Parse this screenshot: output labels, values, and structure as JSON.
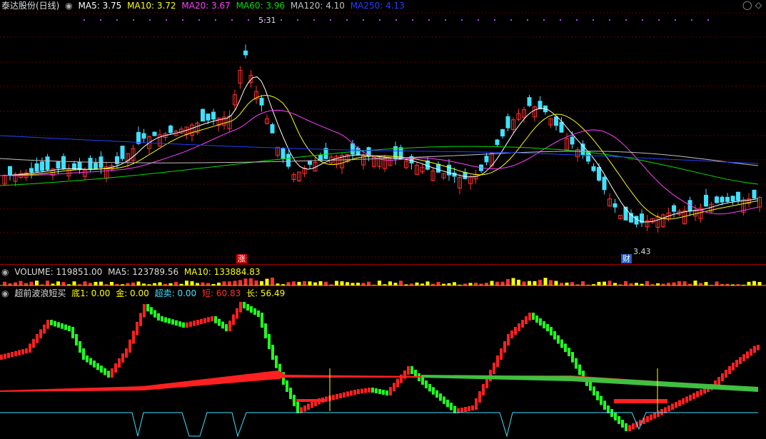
{
  "main_header": {
    "stock": "泰达股份(日线)",
    "ma": [
      {
        "label": "MA5: 3.75",
        "color": "#ffffff"
      },
      {
        "label": "MA10: 3.72",
        "color": "#ffff00"
      },
      {
        "label": "MA20: 3.67",
        "color": "#ff40ff"
      },
      {
        "label": "MA60: 3.96",
        "color": "#00e000"
      },
      {
        "label": "MA120: 4.10",
        "color": "#c0c0c0"
      },
      {
        "label": "MA250: 4.13",
        "color": "#2040ff"
      }
    ]
  },
  "main_chart": {
    "high_label": "5.31",
    "low_label": "3.43",
    "badge_zhang": "涨",
    "badge_cai": "财",
    "up_color": "#ff3030",
    "down_color": "#40e0ff",
    "ylim": [
      3.2,
      5.45
    ]
  },
  "volume_header": {
    "label": "VOLUME: 119851.00",
    "ma5": "MA5: 123789.56",
    "ma10": "MA10: 133884.83"
  },
  "indicator_header": {
    "name": "超前波浪短买",
    "items": [
      {
        "label": "底1: 0.00",
        "color": "#ffff00"
      },
      {
        "label": "金: 0.00",
        "color": "#ffff00"
      },
      {
        "label": "超卖: 0.00",
        "color": "#40e0ff"
      },
      {
        "label": "短: 60.83",
        "color": "#ff3030"
      },
      {
        "label": "长: 56.49",
        "color": "#ffff00"
      }
    ]
  },
  "window_controls": {
    "close_glyph": "◯",
    "diamond_glyph": "◇"
  }
}
